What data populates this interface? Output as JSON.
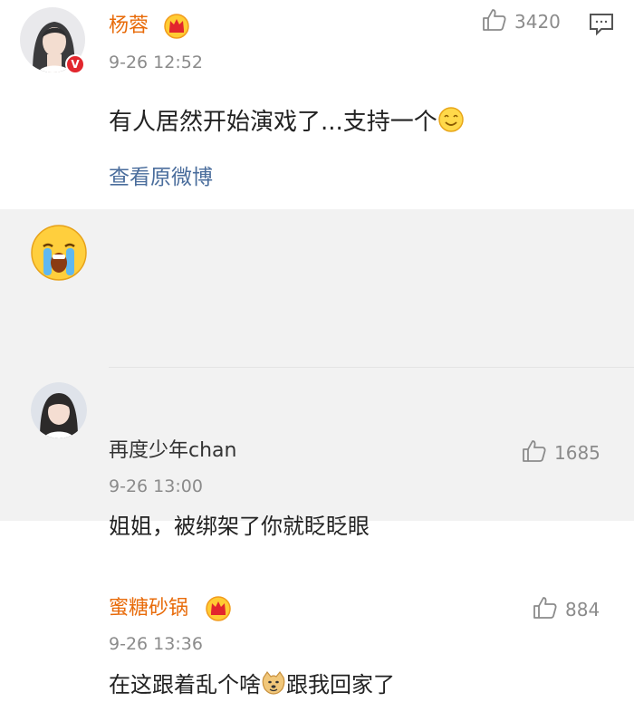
{
  "main_comment": {
    "username": "杨蓉",
    "time": "9-26 12:52",
    "like_count": "3420",
    "content_before_emoji": "有人居然开始演戏了...支持一个",
    "emoji": "smile-emoji",
    "view_original_label": "查看原微博"
  },
  "replies": [
    {
      "username": "再度少年chan",
      "time": "9-26 13:00",
      "like_count": "1685",
      "content": "姐姐，被绑架了你就眨眨眼",
      "avatar": "crying-emoji-avatar"
    },
    {
      "username": "蜜糖砂锅",
      "time": "9-26 13:36",
      "like_count": "884",
      "content_before_emoji": "在这跟着乱个啥",
      "emoji": "doge-emoji",
      "content_after_emoji": "跟我回家了",
      "avatar": "girl-photo-avatar"
    }
  ],
  "colors": {
    "vip_name": "#e86b0a",
    "normal_name": "#333333",
    "link": "#4a6d9c",
    "muted": "#8b8b8b",
    "reply_bg": "#f2f2f2"
  }
}
